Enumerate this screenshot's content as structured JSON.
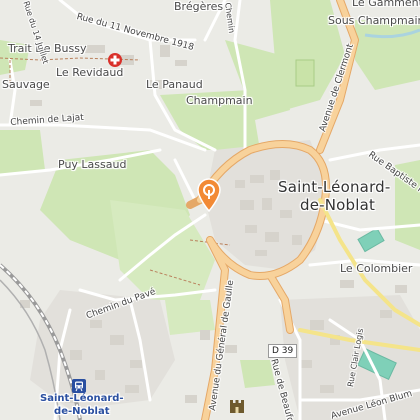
{
  "map": {
    "places": {
      "bregeres": "Brégères",
      "trait_de_bussy": "Trait De Bussy",
      "le_revidaud": "Le Revidaud",
      "sauvage": "Sauvage",
      "le_panaud": "Le Panaud",
      "champmain": "Champmain",
      "puy_lassaud": "Puy Lassaud",
      "town_line1": "Saint-Léonard-",
      "town_line2": "de-Noblat",
      "sous_champmain": "Sous Champmain",
      "le_gamment": "Le Gamment",
      "le_colombier": "Le Colombier"
    },
    "streets": {
      "rue_11_novembre": "Rue du 11 Novembre 1918",
      "chemin_de_lajat": "Chemin de Lajat",
      "chemin_du_pave": "Chemin du Pavé",
      "avenue_de_clermont": "Avenue de Clermont",
      "rue_baptiste_marcet": "Rue Baptiste Marcet",
      "avenue_general_de_gaulle": "Avenue du Général de Gaulle",
      "rue_de_beaufort": "Rue de Beaufort",
      "avenue_leon_blum": "Avenue Léon Blum",
      "rue_clair_logis": "Rue Clair Logis",
      "rue_juillet": "Rue du 14 Juillet",
      "chemin_top": "Chemin"
    },
    "roads": {
      "d39": "D 39"
    },
    "station": {
      "line1": "Saint-Léonard-",
      "line2": "de-Noblat"
    },
    "icons": {
      "location_pin": "location-pin-icon",
      "hospital": "hospital-cross-icon",
      "train_station": "train-station-icon",
      "castle": "castle-icon"
    },
    "colors": {
      "background": "#ebebe6",
      "green": "#cfe6b5",
      "major_road": "#f6c98b",
      "pin": "#f28a35",
      "hospital": "#d9302a",
      "station_text": "#2a4fa0"
    }
  }
}
